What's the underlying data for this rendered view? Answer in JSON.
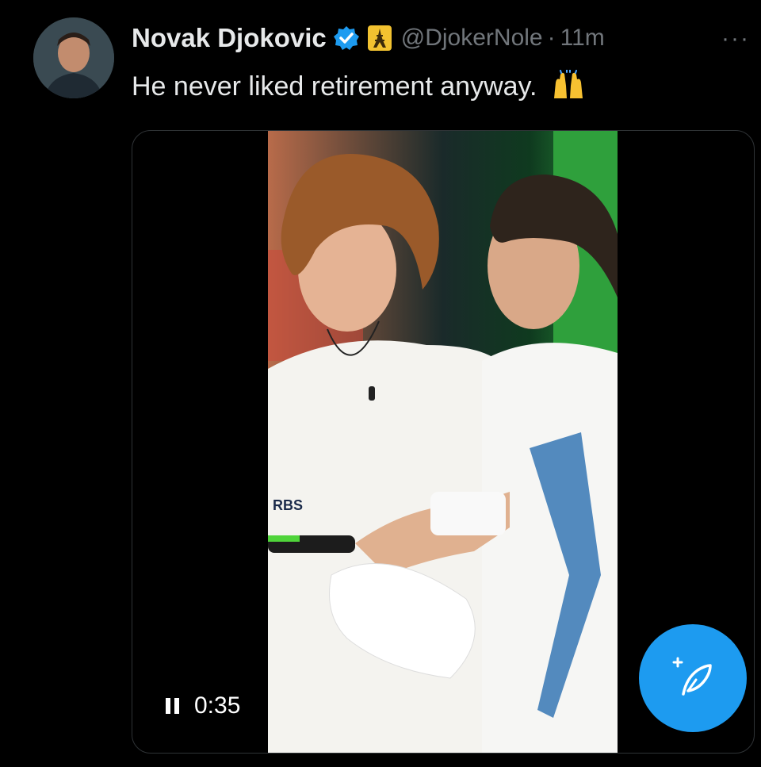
{
  "post": {
    "author_name": "Novak Djokovic",
    "handle": "@DjokerNole",
    "separator": "·",
    "time": "11m",
    "more": "···",
    "text": "He never liked retirement anyway.",
    "emoji_icon": "raising-hands-icon",
    "verified_icon": "verified-badge-icon",
    "affiliate_icon": "eiffel-tower-icon"
  },
  "media": {
    "video_time": "0:35",
    "pause_icon": "pause-icon",
    "sponsor_text": "RBS"
  },
  "fab": {
    "icon": "compose-post-icon",
    "plus": "+"
  },
  "colors": {
    "accent": "#1d9bf0",
    "secondary_text": "#71767b",
    "background": "#000000"
  }
}
